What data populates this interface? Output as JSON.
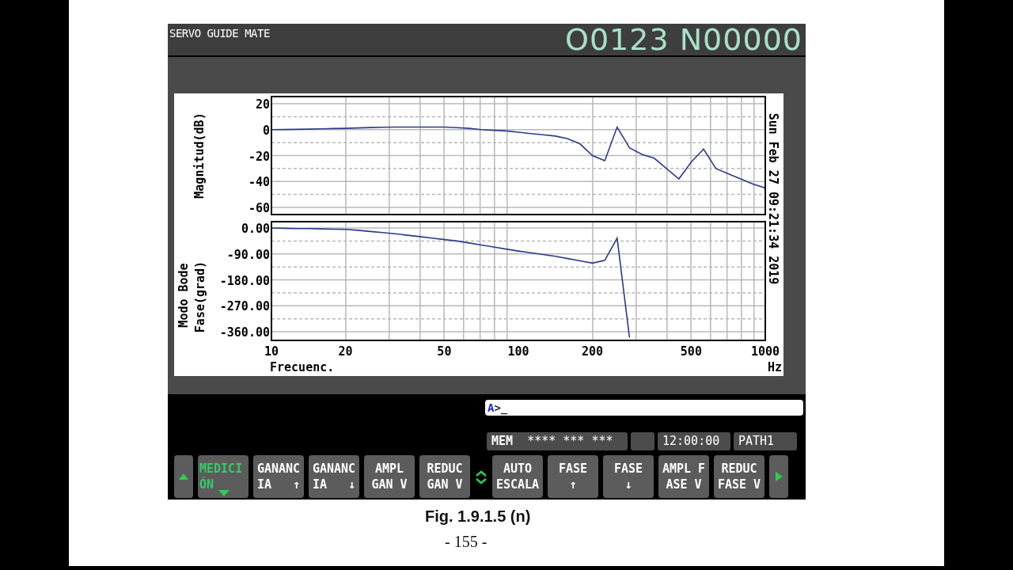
{
  "header": {
    "title": "SERVO GUIDE MATE",
    "program_number": "O0123 N00000"
  },
  "plot": {
    "timestamp": "Sun Feb 27 09:21:34 2019",
    "mode_label": "Modo Bode",
    "unit": "Hz",
    "charts": [
      {
        "chart_data": {
          "type": "line",
          "ylabel": "Magnitud(dB)",
          "values": [
            0,
            0.1,
            0.2,
            0.4,
            0.6,
            0.8,
            1,
            1.3,
            1.6,
            1.8,
            2,
            2,
            2,
            2,
            2,
            1.5,
            1,
            0,
            -0.5,
            -1,
            -2,
            -3,
            -4,
            -5,
            -7,
            -11,
            -20,
            -24,
            2,
            -14,
            -19,
            -22,
            -30,
            -38,
            -25,
            -15,
            -30,
            -34,
            -38,
            -42,
            -45
          ],
          "grid": true,
          "ylim": [
            -65.5,
            25.5
          ],
          "yticks": [
            20,
            0,
            -20,
            -40,
            -60
          ]
        }
      },
      {
        "chart_data": {
          "type": "line",
          "xlabel": "Frecuenc.",
          "ylabel": "Fase(grad)",
          "categories": [
            "10",
            null,
            null,
            null,
            null,
            null,
            "20",
            null,
            null,
            null,
            null,
            null,
            null,
            null,
            "50",
            null,
            null,
            null,
            null,
            null,
            "100",
            null,
            null,
            null,
            null,
            null,
            "200",
            null,
            null,
            null,
            null,
            null,
            null,
            null,
            "500",
            null,
            null,
            null,
            null,
            null,
            "1000"
          ],
          "values": [
            0,
            -1,
            -2,
            -2,
            -3,
            -4,
            -5,
            -8,
            -12,
            -16,
            -20,
            -25,
            -30,
            -35,
            -40,
            -45,
            -52,
            -59,
            -66,
            -73,
            -80,
            -86,
            -92,
            -98,
            -106,
            -114,
            -122,
            -112,
            -35,
            -380,
            null,
            null,
            null,
            null,
            null,
            null,
            null,
            null,
            null,
            null,
            null
          ],
          "grid": true,
          "ylim": [
            -390,
            22
          ],
          "yticks": [
            {
              "value": 0,
              "label": "0.00"
            },
            {
              "value": -90,
              "label": "-90.00"
            },
            {
              "value": -180,
              "label": "-180.00"
            },
            {
              "value": -270,
              "label": "-270.00"
            },
            {
              "value": -360,
              "label": "-360.00"
            }
          ]
        }
      }
    ]
  },
  "input_line": {
    "axis": "A",
    "text": ">_"
  },
  "status_bar": {
    "mode": "MEM",
    "state": "**** *** ***",
    "time": "12:00:00",
    "path": "PATH1"
  },
  "softkeys": [
    {
      "kind": "prev"
    },
    {
      "kind": "key",
      "lines": [
        "MEDICI",
        "ÓN"
      ],
      "selected": true,
      "submenu": true
    },
    {
      "kind": "key",
      "lines": [
        "GANANC",
        "IA   ↑"
      ],
      "selected": false,
      "submenu": false
    },
    {
      "kind": "key",
      "lines": [
        "GANANC",
        "IA   ↓"
      ],
      "selected": false,
      "submenu": false
    },
    {
      "kind": "key",
      "lines": [
        "AMPL",
        "GAN V"
      ],
      "selected": false,
      "submenu": false
    },
    {
      "kind": "key",
      "lines": [
        "REDUC",
        "GAN V"
      ],
      "selected": false,
      "submenu": false
    },
    {
      "kind": "switch"
    },
    {
      "kind": "key",
      "lines": [
        "AUTO",
        "ESCALA"
      ],
      "selected": false,
      "submenu": false
    },
    {
      "kind": "key",
      "lines": [
        "FASE",
        "↑"
      ],
      "selected": false,
      "submenu": false
    },
    {
      "kind": "key",
      "lines": [
        "FASE",
        "↓"
      ],
      "selected": false,
      "submenu": false
    },
    {
      "kind": "key",
      "lines": [
        "AMPL F",
        "ASE V"
      ],
      "selected": false,
      "submenu": false
    },
    {
      "kind": "key",
      "lines": [
        "REDUC",
        "FASE V"
      ],
      "selected": false,
      "submenu": false
    },
    {
      "kind": "next"
    }
  ],
  "document": {
    "caption": "Fig. 1.9.1.5 (n)",
    "page_number": "- 155 -"
  }
}
